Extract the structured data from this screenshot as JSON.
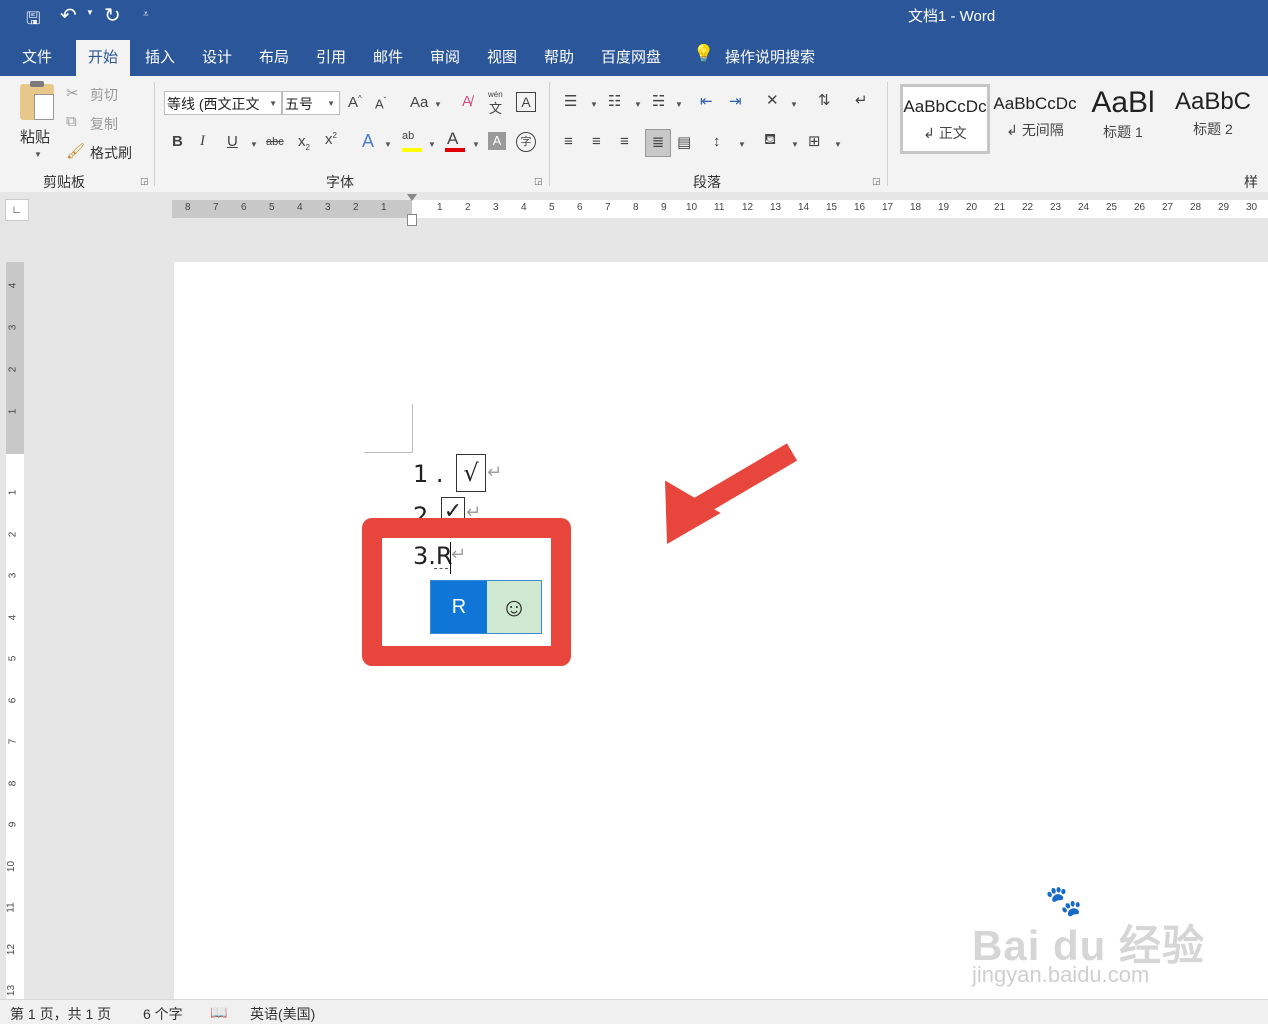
{
  "window": {
    "title": "文档1  -  Word"
  },
  "quick_access": {
    "save_icon": "save-icon",
    "undo_icon": "undo-icon",
    "redo_icon": "redo-icon",
    "customize_icon": "customize-qat-icon"
  },
  "menu": {
    "items": [
      "文件",
      "开始",
      "插入",
      "设计",
      "布局",
      "引用",
      "邮件",
      "审阅",
      "视图",
      "帮助",
      "百度网盘"
    ],
    "search_label": "操作说明搜索"
  },
  "ribbon": {
    "clipboard": {
      "paste": "粘贴",
      "cut": "剪切",
      "copy": "复制",
      "format_painter": "格式刷",
      "label": "剪贴板"
    },
    "font": {
      "font_name": "等线 (西文正文",
      "font_size": "五号",
      "label": "字体",
      "change_case": "Aa",
      "phonetic": "wén",
      "highlight_color": "#ffff00",
      "font_color": "#e00000"
    },
    "paragraph": {
      "label": "段落"
    },
    "styles": {
      "label": "样式",
      "items": [
        {
          "sample": "AaBbCcDc",
          "name": "正文"
        },
        {
          "sample": "AaBbCcDc",
          "name": "无间隔"
        },
        {
          "sample": "AaBl",
          "name": "标题 1"
        },
        {
          "sample": "AaBbC",
          "name": "标题 2"
        }
      ]
    }
  },
  "ruler": {
    "left_numbers": [
      "8",
      "7",
      "6",
      "5",
      "4",
      "3",
      "2",
      "1"
    ],
    "right_numbers": [
      "1",
      "2",
      "3",
      "4",
      "5",
      "6",
      "7",
      "8",
      "9",
      "10",
      "11",
      "12",
      "13",
      "14",
      "15",
      "16",
      "17",
      "18",
      "19",
      "20",
      "21",
      "22",
      "23",
      "24",
      "25",
      "26",
      "27",
      "28",
      "29",
      "30"
    ],
    "vertical_top": [
      "4",
      "3",
      "2",
      "1"
    ],
    "vertical_bottom": [
      "1",
      "2",
      "3",
      "4",
      "5",
      "6",
      "7",
      "8",
      "9",
      "10",
      "11",
      "12",
      "13"
    ]
  },
  "document": {
    "line1": {
      "number": "1 .",
      "symbol": "√"
    },
    "line2": {
      "number": "2",
      "symbol": "✓"
    },
    "line3": {
      "text": "3.R"
    },
    "paragraph_mark": "↵",
    "autocomplete": {
      "option1": "R",
      "option2": "☺"
    }
  },
  "annotation": {
    "highlight_color": "#e8453c",
    "arrow_color": "#e8453c"
  },
  "status": {
    "page": "第 1 页，共 1 页",
    "words": "6 个字",
    "language": "英语(美国)"
  },
  "watermark": {
    "brand": "Bai du 经验",
    "url": "jingyan.baidu.com"
  }
}
